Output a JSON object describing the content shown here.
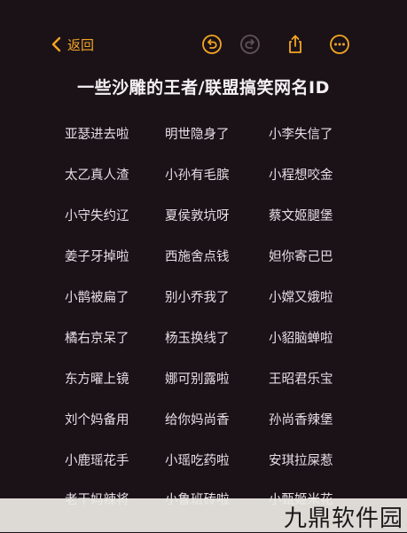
{
  "toolbar": {
    "back_label": "返回",
    "accent_color": "#f3a623",
    "icons": [
      "chevron-left-icon",
      "undo-icon",
      "redo-icon",
      "share-icon",
      "more-icon"
    ]
  },
  "title": "一些沙雕的王者/联盟搞笑网名ID",
  "names": [
    [
      "亚瑟进去啦",
      "明世隐身了",
      "小李失信了"
    ],
    [
      "太乙真人渣",
      "小孙有毛膑",
      "小程想咬金"
    ],
    [
      "小守失约辽",
      "夏侯敦坑呀",
      "蔡文姬腿堡"
    ],
    [
      "姜子牙掉啦",
      "西施舍点钱",
      "妲你寄己巴"
    ],
    [
      "小鹊被扁了",
      "别小乔我了",
      "小嫦又娥啦"
    ],
    [
      "橘右京呆了",
      "杨玉换线了",
      "小貂脑蝉啦"
    ],
    [
      "东方曜上镜",
      "娜可别露啦",
      "王昭君乐宝"
    ],
    [
      "刘个妈备用",
      "给你妈尚香",
      "孙尚香辣堡"
    ],
    [
      "小鹿瑶花手",
      "小瑶吃药啦",
      "安琪拉屎惹"
    ],
    [
      "老干妈辣将",
      "小鲁班砖啦",
      "小甄姬米花"
    ]
  ],
  "watermark": "九鼎软件园"
}
